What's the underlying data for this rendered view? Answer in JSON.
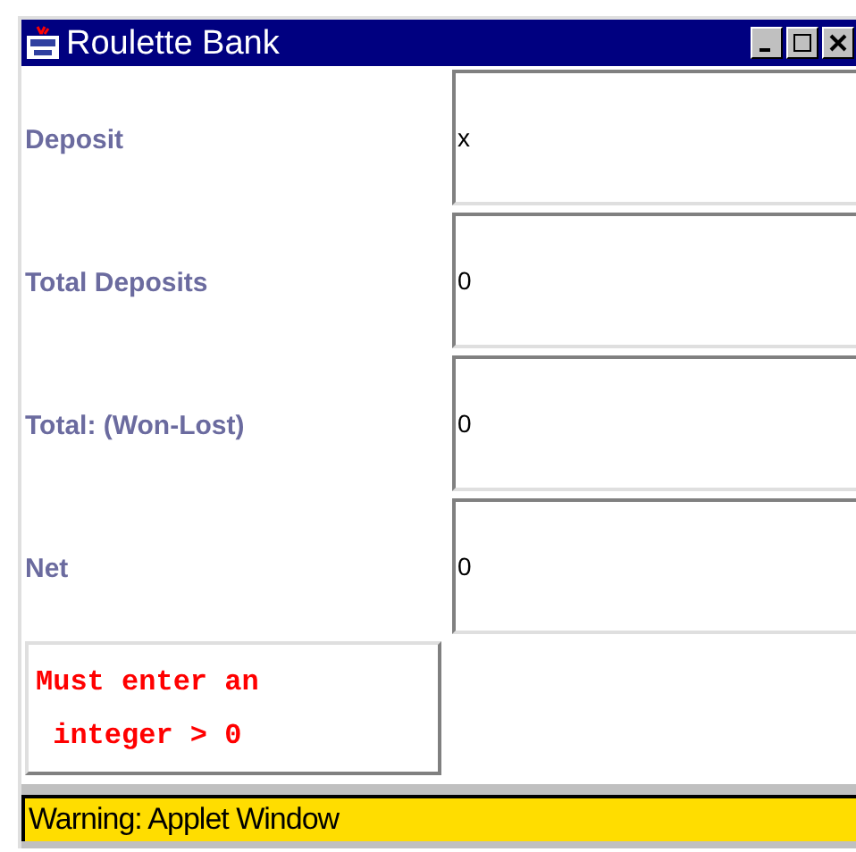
{
  "window": {
    "title": "Roulette Bank"
  },
  "fields": [
    {
      "label": "Deposit",
      "value": "x"
    },
    {
      "label": "Total Deposits",
      "value": "0"
    },
    {
      "label": "Total: (Won-Lost)",
      "value": "0"
    },
    {
      "label": "Net",
      "value": "0"
    }
  ],
  "message": {
    "lines": [
      "Must enter an",
      " integer > 0"
    ]
  },
  "status_bar": "Warning: Applet Window"
}
